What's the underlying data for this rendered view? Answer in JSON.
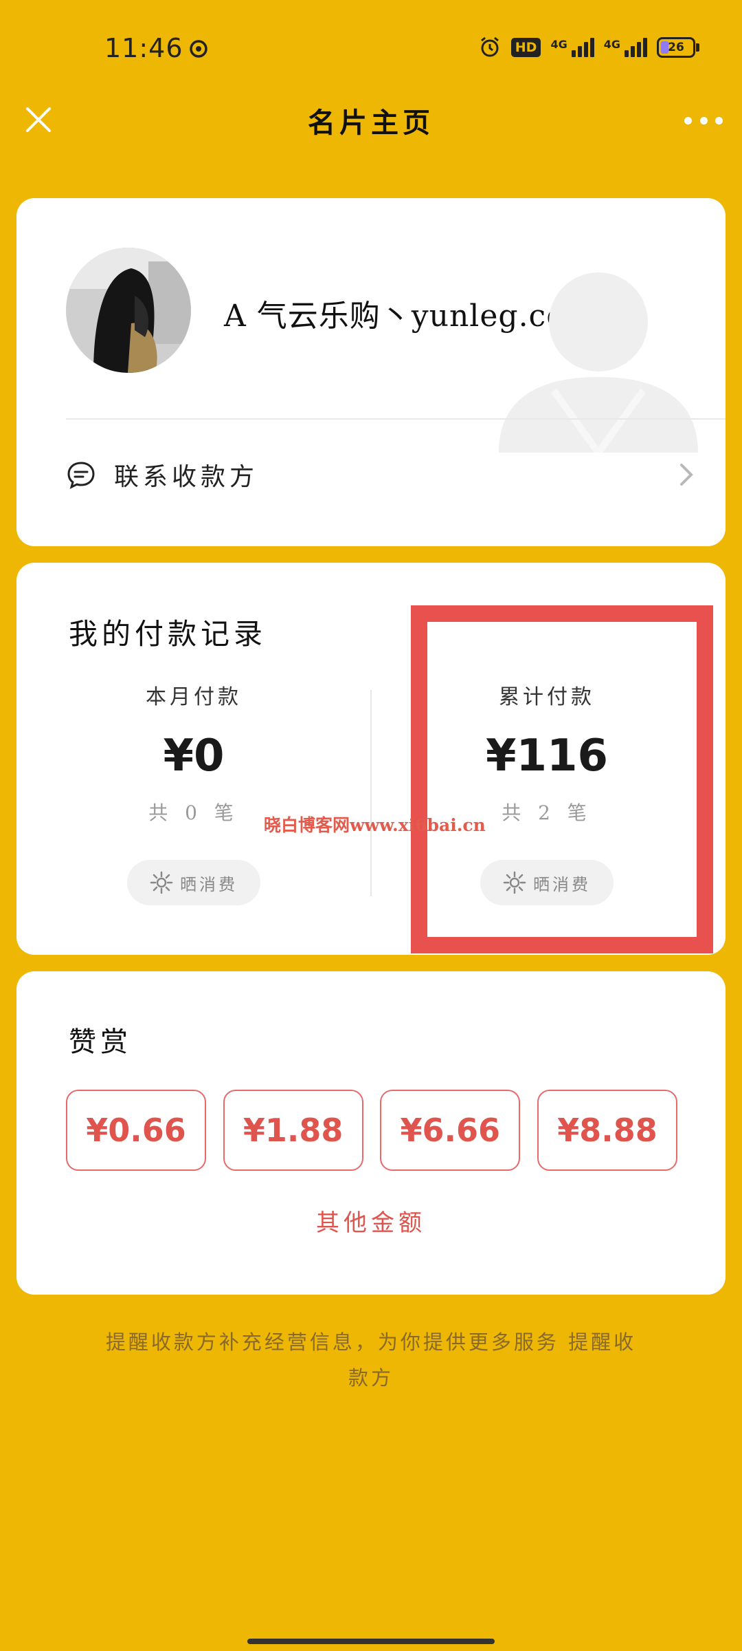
{
  "status_bar": {
    "time": "11:46",
    "hd_label": "HD",
    "network_1": "4G",
    "network_2": "4G",
    "battery": "26",
    "battery_level_percent": 26
  },
  "header": {
    "title": "名片主页"
  },
  "profile": {
    "name": "A 气云乐购丶yunleg.com",
    "contact_label": "联系收款方"
  },
  "records": {
    "title": "我的付款记录",
    "month": {
      "label": "本月付款",
      "value": "¥0",
      "count": "共 0 笔",
      "share_label": "晒消费"
    },
    "total": {
      "label": "累计付款",
      "value": "¥116",
      "count": "共 2 笔",
      "share_label": "晒消费"
    },
    "watermark": "晓白博客网www.xi6bai.cn"
  },
  "reward": {
    "title": "赞赏",
    "amounts": [
      "¥0.66",
      "¥1.88",
      "¥6.66",
      "¥8.88"
    ],
    "other_label": "其他金额"
  },
  "footer": {
    "note": "提醒收款方补充经营信息，为你提供更多服务 提醒收款方"
  },
  "colors": {
    "background": "#EDB704",
    "accent_red": "#E0544E",
    "highlight_box": "#E8514E",
    "card": "#FFFFFF"
  },
  "icons": [
    "close-icon",
    "more-icon",
    "chat-bubble-icon",
    "chevron-right-icon",
    "sparkle-icon",
    "alarm-icon"
  ]
}
